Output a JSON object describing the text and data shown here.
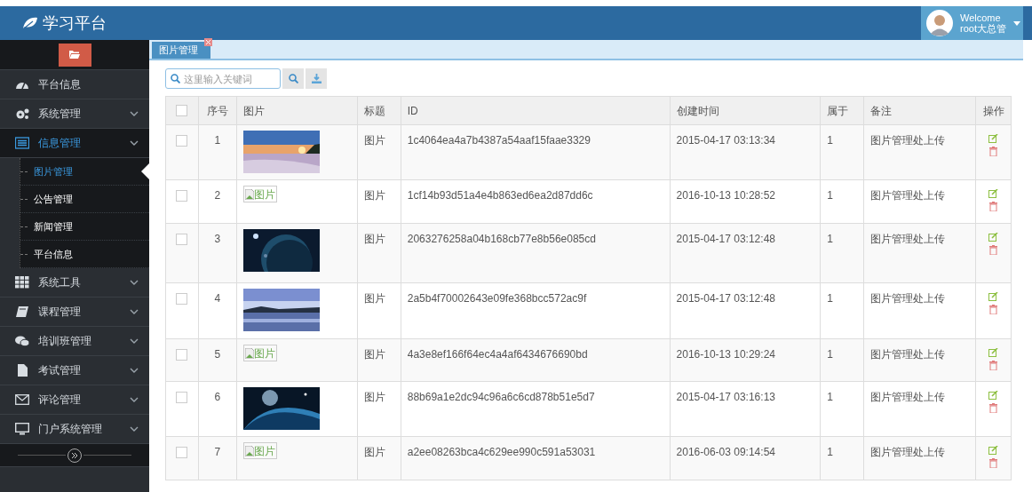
{
  "header": {
    "title": "学习平台",
    "user": {
      "greeting": "Welcome",
      "name": "root大总管"
    }
  },
  "sidebar": {
    "items": [
      {
        "label": "平台信息",
        "kind": "link",
        "expanded": false
      },
      {
        "label": "系统管理",
        "kind": "menu",
        "expanded": false
      },
      {
        "label": "信息管理",
        "kind": "menu",
        "expanded": true,
        "children": [
          {
            "label": "图片管理",
            "selected": true
          },
          {
            "label": "公告管理",
            "selected": false
          },
          {
            "label": "新闻管理",
            "selected": false
          },
          {
            "label": "平台信息",
            "selected": false
          }
        ]
      },
      {
        "label": "系统工具",
        "kind": "menu",
        "expanded": false
      },
      {
        "label": "课程管理",
        "kind": "menu",
        "expanded": false
      },
      {
        "label": "培训班管理",
        "kind": "menu",
        "expanded": false
      },
      {
        "label": "考试管理",
        "kind": "menu",
        "expanded": false
      },
      {
        "label": "评论管理",
        "kind": "menu",
        "expanded": false
      },
      {
        "label": "门户系统管理",
        "kind": "menu",
        "expanded": false
      }
    ]
  },
  "tabs": [
    {
      "label": "图片管理",
      "selected": true
    }
  ],
  "search": {
    "placeholder": "这里输入关键词"
  },
  "table": {
    "select_all_checked": false,
    "columns": [
      "序号",
      "图片",
      "标题",
      "ID",
      "创建时间",
      "属于",
      "备注",
      "操作"
    ],
    "rows": [
      {
        "checked": false,
        "index": "1",
        "title": "图片",
        "id": "1c4064ea4a7b4387a54aaf15faae3329",
        "created": "2015-04-17 03:13:34",
        "belongs": "1",
        "note": "图片管理处上传"
      },
      {
        "checked": false,
        "index": "2",
        "image": {
          "kind": "broken",
          "alt": "图片"
        },
        "title": "图片",
        "id": "1cf14b93d51a4e4b863ed6ea2d87dd6c",
        "created": "2016-10-13 10:28:52",
        "belongs": "1",
        "note": "图片管理处上传"
      },
      {
        "checked": false,
        "index": "3",
        "title": "图片",
        "id": "2063276258a04b168cb77e8b56e085cd",
        "created": "2015-04-17 03:12:48",
        "belongs": "1",
        "note": "图片管理处上传"
      },
      {
        "checked": false,
        "index": "4",
        "title": "图片",
        "id": "2a5b4f70002643e09fe368bcc572ac9f",
        "created": "2015-04-17 03:12:48",
        "belongs": "1",
        "note": "图片管理处上传"
      },
      {
        "checked": false,
        "index": "5",
        "image": {
          "kind": "broken",
          "alt": "图片"
        },
        "title": "图片",
        "id": "4a3e8ef166f64ec4a4af6434676690bd",
        "created": "2016-10-13 10:29:24",
        "belongs": "1",
        "note": "图片管理处上传"
      },
      {
        "checked": false,
        "index": "6",
        "title": "图片",
        "id": "88b69a1e2dc94c96a6c6cd878b51e5d7",
        "created": "2015-04-17 03:16:13",
        "belongs": "1",
        "note": "图片管理处上传"
      },
      {
        "checked": false,
        "index": "7",
        "image": {
          "kind": "broken",
          "alt": "图片"
        },
        "title": "图片",
        "id": "a2ee08263bca4c629ee990c591a53031",
        "created": "2016-06-03 09:14:54",
        "belongs": "1",
        "note": "图片管理处上传"
      }
    ]
  }
}
